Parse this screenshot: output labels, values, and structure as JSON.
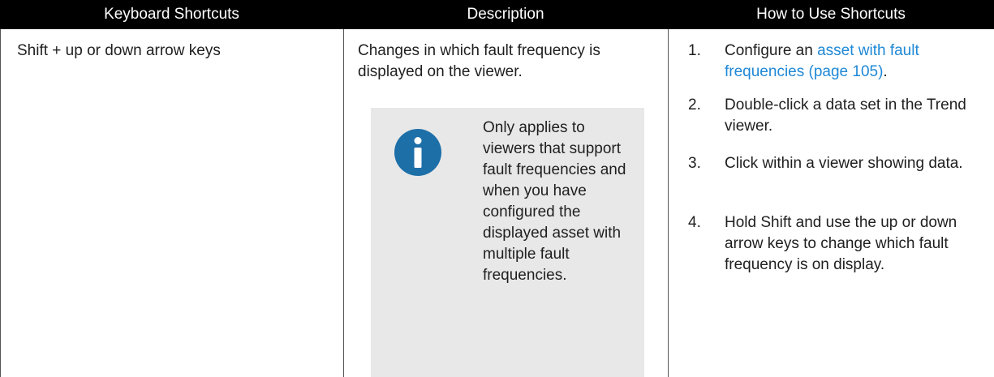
{
  "table": {
    "headers": [
      "Keyboard Shortcuts",
      "Description",
      "How to Use Shortcuts"
    ],
    "row": {
      "shortcut": "Shift + up or down arrow keys",
      "description": "Changes in which fault frequency is displayed on the viewer.",
      "note": {
        "icon": "info-icon",
        "text": "Only applies to viewers that support fault frequencies and when you have configured the displayed asset with multiple fault frequencies."
      },
      "steps": [
        {
          "number": "1.",
          "text_before": "Configure an ",
          "link": "asset with fault frequencies (page 105)",
          "text_after": "."
        },
        {
          "number": "2.",
          "text": "Double-click a data set in the Trend viewer."
        },
        {
          "number": "3.",
          "text": "Click within a viewer showing data."
        },
        {
          "number": "4.",
          "text": "Hold Shift and use the up or down arrow keys to change which fault frequency is on display."
        }
      ]
    }
  },
  "colors": {
    "header_bg": "#000000",
    "header_text": "#ffffff",
    "link": "#1e88d6",
    "note_bg": "#e8e8e8",
    "icon": "#1d6fa8"
  }
}
